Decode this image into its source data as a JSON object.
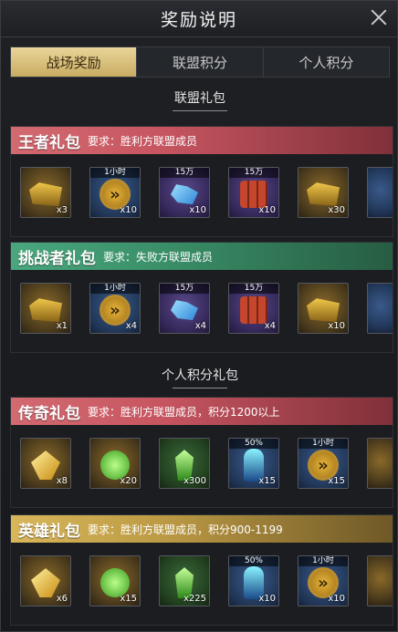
{
  "title": "奖励说明",
  "tabs": [
    {
      "label": "战场奖励",
      "active": true
    },
    {
      "label": "联盟积分",
      "active": false
    },
    {
      "label": "个人积分",
      "active": false
    }
  ],
  "sections": [
    {
      "title": "联盟礼包"
    },
    {
      "title": "个人积分礼包"
    }
  ],
  "packs": [
    {
      "name": "王者礼包",
      "requirement": "要求：胜利方联盟成员",
      "color": "#c65560",
      "items": [
        {
          "icon": "machine-part-icon",
          "quality": "orange",
          "badge": "",
          "qty": "x3"
        },
        {
          "icon": "speedup-chevron-icon",
          "quality": "blue",
          "badge": "1小时",
          "qty": "x10"
        },
        {
          "icon": "blue-crystal-icon",
          "quality": "purple",
          "badge": "15万",
          "qty": "x10"
        },
        {
          "icon": "oil-barrel-icon",
          "quality": "purple",
          "badge": "15万",
          "qty": "x10"
        },
        {
          "icon": "gold-mech-icon",
          "quality": "orange",
          "badge": "",
          "qty": "x30"
        },
        {
          "icon": "partial-item-icon",
          "quality": "blue",
          "badge": "",
          "qty": ""
        }
      ]
    },
    {
      "name": "挑战者礼包",
      "requirement": "要求：失败方联盟成员",
      "color": "#3a8f68",
      "items": [
        {
          "icon": "machine-part-icon",
          "quality": "orange",
          "badge": "",
          "qty": "x1"
        },
        {
          "icon": "speedup-chevron-icon",
          "quality": "blue",
          "badge": "1小时",
          "qty": "x4"
        },
        {
          "icon": "blue-crystal-icon",
          "quality": "purple",
          "badge": "15万",
          "qty": "x4"
        },
        {
          "icon": "oil-barrel-icon",
          "quality": "purple",
          "badge": "15万",
          "qty": "x4"
        },
        {
          "icon": "gold-mech-icon",
          "quality": "orange",
          "badge": "",
          "qty": "x10"
        },
        {
          "icon": "partial-item-icon",
          "quality": "blue",
          "badge": "",
          "qty": ""
        }
      ]
    },
    {
      "name": "传奇礼包",
      "requirement": "要求：胜利方联盟成员，积分1200以上",
      "color": "#c65560",
      "items": [
        {
          "icon": "yellow-gem-icon",
          "quality": "orange",
          "badge": "",
          "qty": "x8"
        },
        {
          "icon": "green-orb-icon",
          "quality": "orange",
          "badge": "",
          "qty": "x20"
        },
        {
          "icon": "green-shard-icon",
          "quality": "green",
          "badge": "",
          "qty": "x300"
        },
        {
          "icon": "runner-boost-icon",
          "quality": "blue",
          "badge": "50%",
          "qty": "x15"
        },
        {
          "icon": "speedup-chevron-icon",
          "quality": "blue",
          "badge": "1小时",
          "qty": "x15"
        },
        {
          "icon": "partial-item-icon",
          "quality": "orange",
          "badge": "",
          "qty": ""
        }
      ]
    },
    {
      "name": "英雄礼包",
      "requirement": "要求：胜利方联盟成员，积分900-1199",
      "color": "#bc9a44",
      "items": [
        {
          "icon": "yellow-gem-icon",
          "quality": "orange",
          "badge": "",
          "qty": "x6"
        },
        {
          "icon": "green-orb-icon",
          "quality": "orange",
          "badge": "",
          "qty": "x15"
        },
        {
          "icon": "green-shard-icon",
          "quality": "green",
          "badge": "",
          "qty": "x225"
        },
        {
          "icon": "runner-boost-icon",
          "quality": "blue",
          "badge": "50%",
          "qty": "x10"
        },
        {
          "icon": "speedup-chevron-icon",
          "quality": "blue",
          "badge": "1小时",
          "qty": "x10"
        },
        {
          "icon": "partial-item-icon",
          "quality": "orange",
          "badge": "",
          "qty": ""
        }
      ]
    }
  ]
}
